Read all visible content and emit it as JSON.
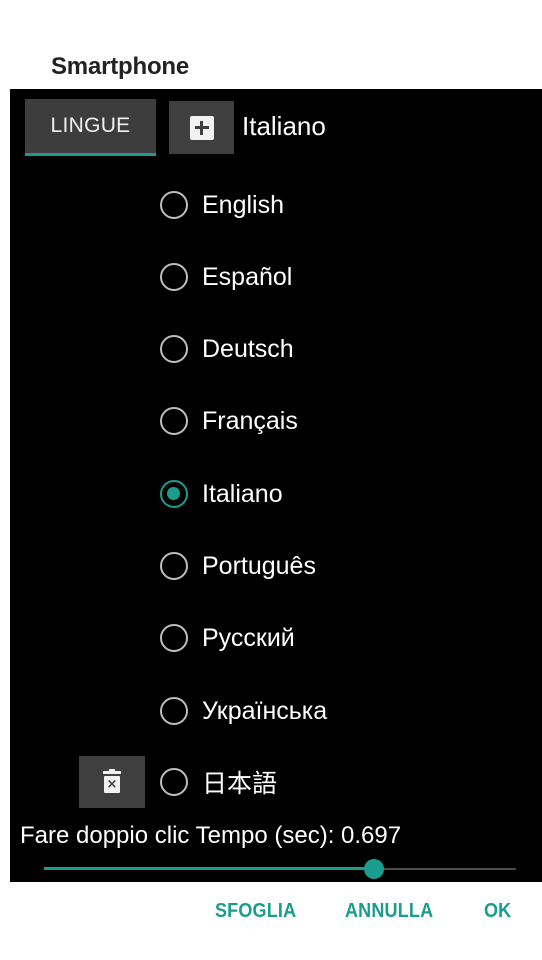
{
  "dialog": {
    "title": "Smartphone"
  },
  "toolbar": {
    "lingue_label": "LINGUE",
    "current_language": "Italiano"
  },
  "languages": [
    {
      "label": "English",
      "selected": false
    },
    {
      "label": "Español",
      "selected": false
    },
    {
      "label": "Deutsch",
      "selected": false
    },
    {
      "label": "Français",
      "selected": false
    },
    {
      "label": "Italiano",
      "selected": true
    },
    {
      "label": "Português",
      "selected": false
    },
    {
      "label": "Русский",
      "selected": false
    },
    {
      "label": "Українська",
      "selected": false
    },
    {
      "label": "日本語",
      "selected": false
    }
  ],
  "double_click": {
    "label": "Fare doppio clic Tempo (sec): 0.697",
    "slider_fraction": 0.7
  },
  "actions": {
    "browse": "SFOGLIA",
    "cancel": "ANNULLA",
    "ok": "OK"
  },
  "colors": {
    "accent": "#1a9d8e",
    "content_background": "#000000",
    "dialog_background": "#ffffff"
  }
}
